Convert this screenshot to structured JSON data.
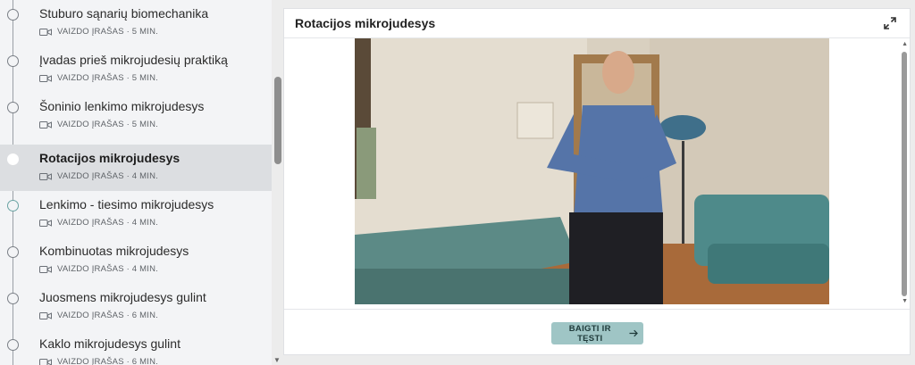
{
  "sidebar": {
    "lessons": [
      {
        "title": "Stuburo sąnarių biomechanika",
        "meta": "VAIZDO ĮRAŠAS · 5 MIN."
      },
      {
        "title": "Įvadas prieš mikrojudesių praktiką",
        "meta": "VAIZDO ĮRAŠAS · 5 MIN."
      },
      {
        "title": "Šoninio lenkimo mikrojudesys",
        "meta": "VAIZDO ĮRAŠAS · 5 MIN."
      },
      {
        "title": "Rotacijos mikrojudesys",
        "meta": "VAIZDO ĮRAŠAS · 4 MIN.",
        "active": true
      },
      {
        "title": "Lenkimo - tiesimo mikrojudesys",
        "meta": "VAIZDO ĮRAŠAS · 4 MIN."
      },
      {
        "title": "Kombinuotas mikrojudesys",
        "meta": "VAIZDO ĮRAŠAS · 4 MIN."
      },
      {
        "title": "Juosmens mikrojudesys gulint",
        "meta": "VAIZDO ĮRAŠAS · 6 MIN."
      },
      {
        "title": "Kaklo mikrojudesys gulint",
        "meta": "VAIZDO ĮRAŠAS · 6 MIN."
      }
    ]
  },
  "content": {
    "title": "Rotacijos mikrojudesys",
    "expand_icon": "expand-icon",
    "continue_label": "BAIGTI IR TĘSTI",
    "continue_icon": "arrow-right-icon"
  },
  "colors": {
    "sidebar_bg": "#f3f4f6",
    "active_bg": "#dcdee1",
    "button_bg": "#9fc5c5"
  }
}
